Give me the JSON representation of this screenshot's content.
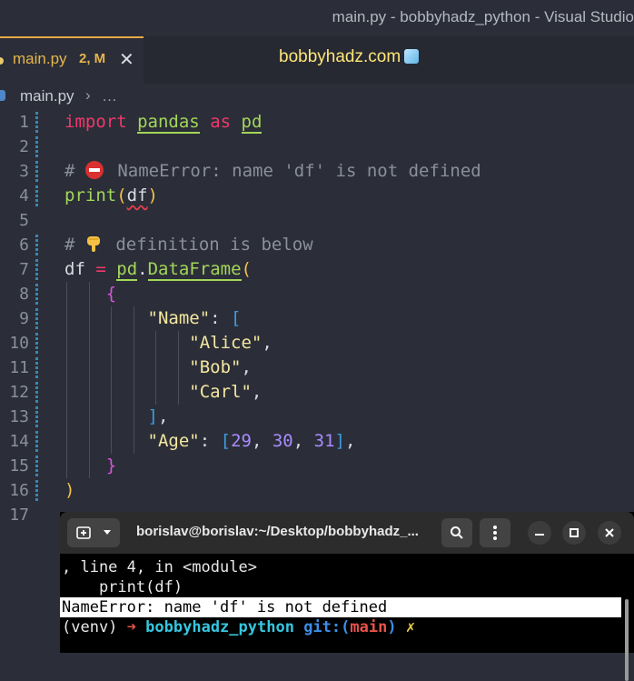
{
  "window": {
    "title": "main.py - bobbyhadz_python - Visual Studio"
  },
  "tab": {
    "filename": "main.py",
    "badge": "2, M",
    "close": "✕"
  },
  "header": {
    "brand": "bobbyhadz.com"
  },
  "breadcrumb": {
    "file": "main.py",
    "separator": "›",
    "more": "…"
  },
  "editor": {
    "lines": [
      {
        "n": "1"
      },
      {
        "n": "2"
      },
      {
        "n": "3"
      },
      {
        "n": "4"
      },
      {
        "n": "5"
      },
      {
        "n": "6"
      },
      {
        "n": "7"
      },
      {
        "n": "8"
      },
      {
        "n": "9"
      },
      {
        "n": "10"
      },
      {
        "n": "11"
      },
      {
        "n": "12"
      },
      {
        "n": "13"
      },
      {
        "n": "14"
      },
      {
        "n": "15"
      },
      {
        "n": "16"
      },
      {
        "n": "17"
      }
    ],
    "code": {
      "kw_import": "import",
      "mod_pandas": "pandas",
      "kw_as": "as",
      "alias_pd": "pd",
      "comment3_prefix": "# ",
      "comment3_text": " NameError: name 'df' is not defined",
      "print": "print",
      "df": "df",
      "comment6_prefix": "# ",
      "comment6_text": " definition is below",
      "df_assign": "df",
      "eq": "=",
      "pd": "pd",
      "dot": ".",
      "dataframe": "DataFrame",
      "key_name": "\"Name\"",
      "val_alice": "\"Alice\"",
      "val_bob": "\"Bob\"",
      "val_carl": "\"Carl\"",
      "key_age": "\"Age\"",
      "n29": "29",
      "n30": "30",
      "n31": "31"
    },
    "colors": {
      "keyword": "#f0386b",
      "function": "#a3d65a",
      "string": "#f4e7a1",
      "number": "#a98bff",
      "comment": "#8b8f99"
    }
  },
  "terminal": {
    "title": "borislav@borislav:~/Desktop/bobbyhadz_...",
    "lines": [
      ", line 4, in <module>",
      "    print(df)",
      "NameError: name 'df' is not defined"
    ],
    "prompt": {
      "venv": "(venv)",
      "arrow": "➜",
      "project": "bobbyhadz_python",
      "git": "git:(",
      "branch": "main",
      "git_close": ")",
      "dirty": "✗"
    }
  }
}
